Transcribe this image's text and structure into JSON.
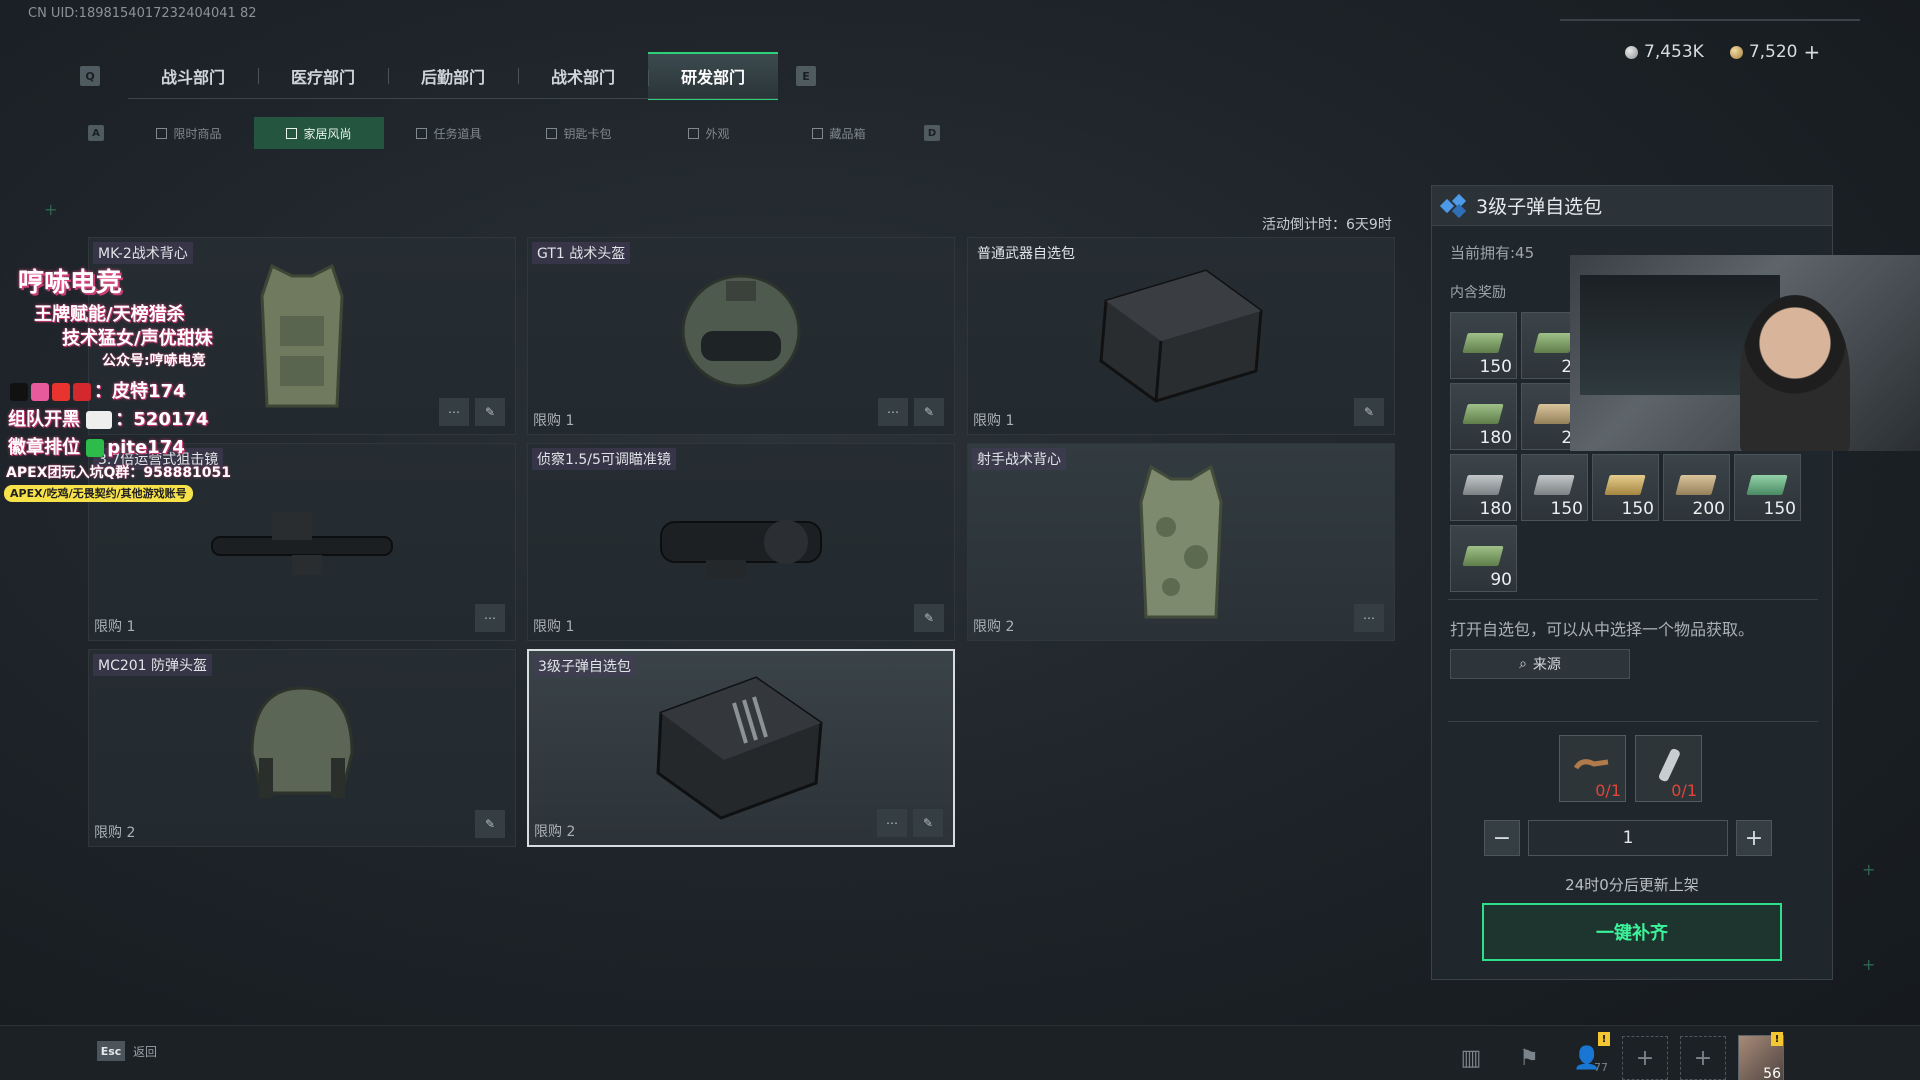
{
  "uid": "CN UID:1898154017232404041 82",
  "currency": [
    {
      "icon": "silver-coin-icon",
      "value": "7,453K"
    },
    {
      "icon": "gold-coin-icon",
      "value": "7,520"
    }
  ],
  "main_tabs": {
    "left_key": "Q",
    "right_key": "E",
    "items": [
      {
        "label": "战斗部门"
      },
      {
        "label": "医疗部门"
      },
      {
        "label": "后勤部门"
      },
      {
        "label": "战术部门"
      },
      {
        "label": "研发部门",
        "active": true
      }
    ]
  },
  "sub_tabs": {
    "left_key": "A",
    "right_key": "D",
    "items": [
      {
        "label": "限时商品"
      },
      {
        "label": "家居风尚",
        "active": true
      },
      {
        "label": "任务道具"
      },
      {
        "label": "钥匙卡包"
      },
      {
        "label": "外观"
      },
      {
        "label": "藏品箱"
      }
    ]
  },
  "countdown": "活动倒计时：6天9时",
  "cards": [
    {
      "name": "MK-2战术背心",
      "limit": "",
      "art": "vest"
    },
    {
      "name": "GT1 战术头盔",
      "limit": "限购 1",
      "art": "helmet-goggles"
    },
    {
      "name": "普通武器自选包",
      "limit": "限购 1",
      "art": "crate"
    },
    {
      "name": "3.7倍运营式狙击镜",
      "limit": "限购 1",
      "art": "scope-long"
    },
    {
      "name": "侦察1.5/5可调瞄准镜",
      "limit": "限购 1",
      "art": "scope-short"
    },
    {
      "name": "射手战术背心",
      "limit": "限购 2",
      "art": "vest-camo"
    },
    {
      "name": "MC201 防弹头盔",
      "limit": "限购 2",
      "art": "helmet"
    },
    {
      "name": "3级子弹自选包",
      "limit": "限购 2",
      "art": "ammo-crate",
      "selected": true
    }
  ],
  "detail": {
    "title": "3级子弹自选包",
    "owned": "当前拥有:45",
    "rewards_label": "内含奖励",
    "rewards": [
      {
        "qty": "150",
        "color": "green"
      },
      {
        "qty": "20",
        "color": "green"
      },
      {
        "qty": "180",
        "color": "green"
      },
      {
        "qty": "20",
        "color": "tan"
      },
      {
        "qty": "180",
        "color": "gray"
      },
      {
        "qty": "150",
        "color": "gray"
      },
      {
        "qty": "150",
        "color": "gold"
      },
      {
        "qty": "200",
        "color": "tan"
      },
      {
        "qty": "150",
        "color": "teal"
      },
      {
        "qty": "90",
        "color": "green"
      }
    ],
    "description": "打开自选包，可以从中选择一个物品获取。",
    "source_label": "来源",
    "requirements": [
      {
        "icon": "pipe-icon",
        "count": "0/1"
      },
      {
        "icon": "tube-icon",
        "count": "0/1"
      }
    ],
    "quantity": "1",
    "refresh_text": "24时0分后更新上架",
    "buy_label": "一键补齐"
  },
  "overlay": {
    "title": "哼哧电竞",
    "line1": "王牌赋能/天榜猎杀",
    "line2": "技术猛女/声优甜妹",
    "line3": "公众号:哼哧电竞",
    "line4": "：皮特174",
    "line5_a": "组队开黑",
    "line5_b": "：520174",
    "line6_a": "徽章排位",
    "line6_b": "pite174",
    "line7": "APEX团玩入坑Q群：958881051",
    "banner": "APEX/吃鸡/无畏契约/其他游戏账号"
  },
  "bottom": {
    "esc_key": "Esc",
    "esc_label": "返回",
    "friends_count": "77",
    "level": "56"
  }
}
